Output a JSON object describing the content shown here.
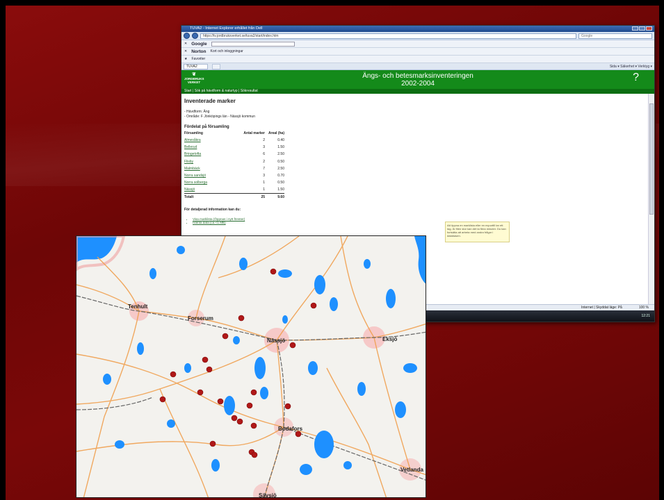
{
  "browser": {
    "window_title": "TUVA2 - Internet Explorer erhållet från Dell",
    "address": "https://tv.jordbruksverket.se/tuva2/start/index.htm",
    "search_placeholder": "Google",
    "toolbar_brand": "Google",
    "norton_label": "Norton",
    "norton_login": "Kort och inloggningar",
    "favorites_label": "Favoriter",
    "tab_label": "TUVA2",
    "command_bar": "Sida ▾  Säkerhet ▾  Verktyg ▾",
    "status_zone": "Internet | Skyddat läge: På",
    "zoom": "100 %",
    "clock": "12:21"
  },
  "site": {
    "logo_line1": "JORDBRUKS",
    "logo_line2": "VERKET",
    "title_line1": "Ängs- och betesmarksinventeringen",
    "title_line2": "2002-2004",
    "help_icon": "?",
    "nav": "Start | Sök på hävdform & naturtyp | Sökresultat"
  },
  "page": {
    "heading": "Inventerade marker",
    "hevdform": "- Hävdform: Äng",
    "omrade": "- Område: F Jönköpings län - Nässjö kommun",
    "section_title": "Fördelat på församling",
    "columns": [
      "Församling",
      "Antal marker",
      "Areal (ha)"
    ],
    "rows": [
      {
        "name": "Almesåkra",
        "count": "2",
        "area": "0.40"
      },
      {
        "name": "Bellerud",
        "count": "3",
        "area": "1.50"
      },
      {
        "name": "Bringetofta",
        "count": "6",
        "area": "2.50"
      },
      {
        "name": "Flisby",
        "count": "2",
        "area": "0.50"
      },
      {
        "name": "Malmbäck",
        "count": "7",
        "area": "2.50"
      },
      {
        "name": "Norra sandsjö",
        "count": "3",
        "area": "0.70"
      },
      {
        "name": "Norra solberga",
        "count": "1",
        "area": "0.50"
      },
      {
        "name": "Nässjö",
        "count": "1",
        "area": "1.50"
      }
    ],
    "total": {
      "name": "Totalt",
      "count": "25",
      "area": "9.60"
    },
    "info_title": "För detaljerad information kan du:",
    "links": [
      "Visa marklista (Öppnas i nytt fönster)",
      "Hämta data (ca <1 MB)"
    ],
    "note": "Att öppna en marklista eller en exportfil tar ett tag. Är filen stor kan det ta flera minuter. Du kan fortsätta att arbeta med andra frågor i databasen."
  },
  "map": {
    "places": [
      "Tenhult",
      "Forserum",
      "Nässjö",
      "Eksjö",
      "Bodafors",
      "Sävsjö",
      "Vetlanda"
    ]
  },
  "colors": {
    "slide_red": "#7a0808",
    "site_green": "#148a1a",
    "marker_red": "#b01818",
    "water_blue": "#1e90ff",
    "road_orange": "#f0a050"
  }
}
